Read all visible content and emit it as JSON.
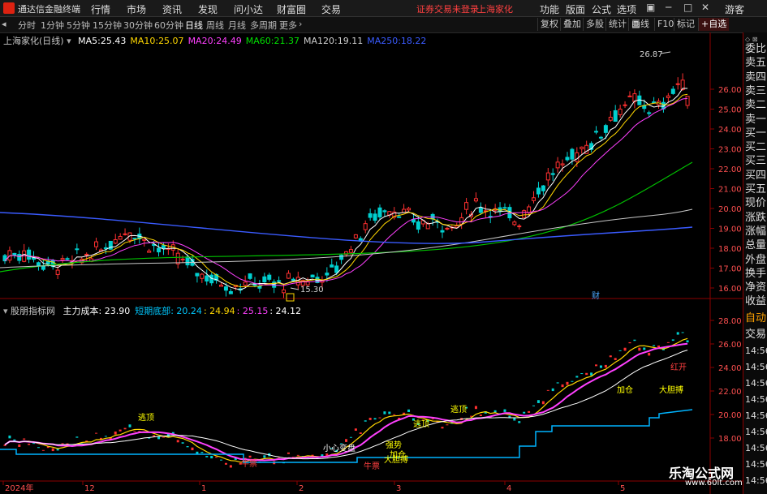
{
  "window": {
    "app_name": "通达信金融终端",
    "status_text": "证券交易未登录",
    "stock_name": "上海家化",
    "right_menu": [
      "功能",
      "版面",
      "公式",
      "选项"
    ],
    "user": "游客"
  },
  "menu": [
    "行情",
    "市场",
    "资讯",
    "发现",
    "问小达",
    "财富圈",
    "交易"
  ],
  "toolbar": {
    "periods": [
      "分时",
      "1分钟",
      "5分钟",
      "15分钟",
      "30分钟",
      "60分钟",
      "日线",
      "周线",
      "月线",
      "多周期",
      "更多"
    ],
    "active_period": "日线",
    "buttons": [
      "复权",
      "叠加",
      "多股",
      "统计",
      "画线",
      "F10",
      "标记",
      "+自选"
    ]
  },
  "main_chart": {
    "title": "上海家化(日线)",
    "ma": [
      {
        "label": "MA5:",
        "value": "25.43",
        "color": "#ffffff"
      },
      {
        "label": "MA10:",
        "value": "25.07",
        "color": "#ffd700"
      },
      {
        "label": "MA20:",
        "value": "24.49",
        "color": "#ff40ff"
      },
      {
        "label": "MA60:",
        "value": "21.37",
        "color": "#00e000"
      },
      {
        "label": "MA120:",
        "value": "19.11",
        "color": "#d0d0d0"
      },
      {
        "label": "MA250:",
        "value": "18.22",
        "color": "#3a5bff"
      }
    ],
    "high_label": "26.87",
    "low_label": "15.30",
    "markers": [
      "财"
    ],
    "y_ticks": [
      "26.00",
      "25.00",
      "24.00",
      "23.00",
      "22.00",
      "21.00",
      "20.00",
      "19.00",
      "18.00",
      "17.00",
      "16.00"
    ]
  },
  "sub_chart": {
    "title": "股朋指标网",
    "items": [
      {
        "text": "主力成本: 23.90",
        "color": "#ffffff"
      },
      {
        "text": "短期底部: 20.24",
        "color": "#00c8ff"
      },
      {
        "text": ": 24.94",
        "color": "#ffd700"
      },
      {
        "text": ": 25.15",
        "color": "#ff40ff"
      },
      {
        "text": ": 24.12",
        "color": "#ffffff"
      }
    ],
    "y_ticks": [
      "28.00",
      "26.00",
      "24.00",
      "22.00",
      "20.00",
      "18.00"
    ],
    "signals": [
      {
        "text": "逃顶",
        "color": "#ffff00"
      },
      {
        "text": "小心变盘",
        "color": "#ffffff"
      },
      {
        "text": "强势",
        "color": "#ffff00"
      },
      {
        "text": "加仓",
        "color": "#ffff00"
      },
      {
        "text": "逃顶",
        "color": "#ffff00"
      },
      {
        "text": "逃顶",
        "color": "#ffff00"
      },
      {
        "text": "加仓",
        "color": "#ffff00"
      },
      {
        "text": "大胆搏",
        "color": "#ffff00"
      },
      {
        "text": "牛票",
        "color": "#ff4040"
      },
      {
        "text": "大胆搏",
        "color": "#ffff00"
      },
      {
        "text": "牛票",
        "color": "#ff4040"
      },
      {
        "text": "红开",
        "color": "#ff4040"
      }
    ]
  },
  "x_axis": [
    "2024年",
    "12",
    "1",
    "2",
    "3",
    "4",
    "5"
  ],
  "side_panel": [
    "委比",
    "卖五",
    "卖四",
    "卖三",
    "卖二",
    "卖一",
    "买一",
    "买二",
    "买三",
    "买四",
    "买五",
    "现价",
    "涨跌",
    "涨幅",
    "总量",
    "外盘",
    "换手",
    "净资",
    "收益"
  ],
  "side_panel2": [
    "自动",
    "交易",
    "14:56",
    "14:56",
    "14:56",
    "14:56",
    "14:56",
    "14:56",
    "14:56",
    "14:56",
    "14:56"
  ],
  "watermark": {
    "line1": "乐淘公式网",
    "line2": "www.60lt.com"
  }
}
